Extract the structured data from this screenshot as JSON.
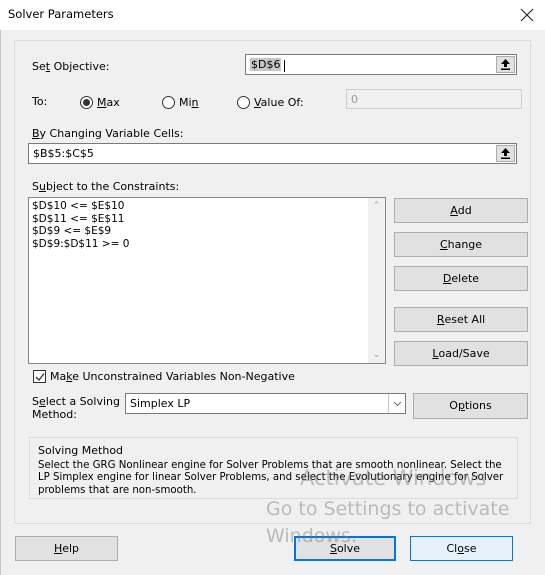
{
  "window": {
    "title": "Solver Parameters",
    "close_icon": "close-icon"
  },
  "objective": {
    "label_prefix": "Se",
    "label_mnemonic": "t",
    "label_suffix": " Objective:",
    "value": "$D$6"
  },
  "to": {
    "label": "To:",
    "options": [
      {
        "prefix": "",
        "mnemonic": "M",
        "suffix": "ax",
        "selected": true
      },
      {
        "prefix": "Mi",
        "mnemonic": "n",
        "suffix": "",
        "selected": false
      },
      {
        "prefix": "",
        "mnemonic": "V",
        "suffix": "alue Of:",
        "selected": false
      }
    ],
    "value_of": "0"
  },
  "changing_cells": {
    "label_mnemonic": "B",
    "label_suffix": "y Changing Variable Cells:",
    "value": "$B$5:$C$5"
  },
  "constraints": {
    "label_prefix": "S",
    "label_mnemonic": "u",
    "label_suffix": "bject to the Constraints:",
    "items": [
      "$D$10 <= $E$10",
      "$D$11 <= $E$11",
      "$D$9 <= $E$9",
      "$D$9:$D$11 >= 0"
    ]
  },
  "constraint_buttons": {
    "add": {
      "mnemonic": "A",
      "suffix": "dd"
    },
    "change": {
      "mnemonic": "C",
      "suffix": "hange"
    },
    "delete": {
      "mnemonic": "D",
      "suffix": "elete"
    },
    "reset_all": {
      "mnemonic": "R",
      "suffix": "eset All"
    },
    "load_save": {
      "mnemonic": "L",
      "suffix": "oad/Save"
    }
  },
  "non_negative": {
    "checked": true,
    "prefix": "Ma",
    "mnemonic": "k",
    "suffix": "e Unconstrained Variables Non-Negative"
  },
  "solving_method": {
    "label_prefix": "S",
    "label_mnemonic": "e",
    "label_line1_suffix": "lect a Solving",
    "label_line2": "Method:",
    "selected": "Simplex LP",
    "options_button": {
      "prefix": "O",
      "mnemonic": "p",
      "suffix": "tions"
    }
  },
  "method_info": {
    "title": "Solving Method",
    "description": "Select the GRG Nonlinear engine for Solver Problems that are smooth nonlinear. Select the LP Simplex engine for linear Solver Problems, and select the Evolutionary engine for Solver problems that are non-smooth."
  },
  "footer": {
    "help": {
      "mnemonic": "H",
      "suffix": "elp"
    },
    "solve": {
      "mnemonic": "S",
      "suffix": "olve"
    },
    "close": {
      "prefix": "Cl",
      "mnemonic": "o",
      "suffix": "se"
    }
  },
  "watermark": {
    "line1": "Activate Windows",
    "line2": "Go to Settings to activate",
    "line3": "Windows."
  }
}
